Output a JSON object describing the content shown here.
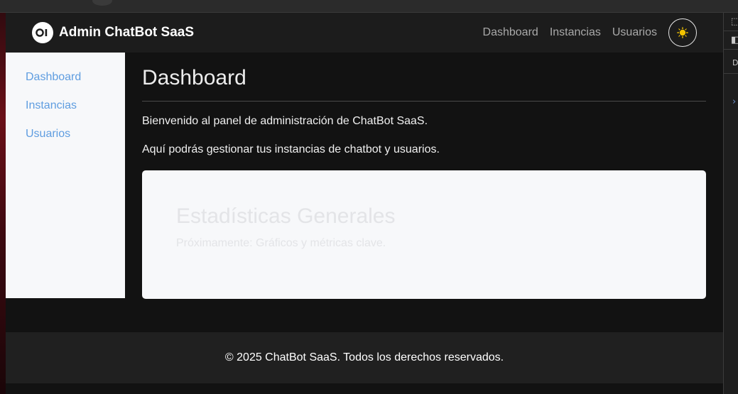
{
  "navbar": {
    "brand_logo": "OI",
    "brand": "Admin ChatBot SaaS",
    "links": [
      "Dashboard",
      "Instancias",
      "Usuarios"
    ],
    "theme_icon": "sun-icon",
    "theme_icon_color": "#f2c200"
  },
  "sidebar": {
    "items": [
      "Dashboard",
      "Instancias",
      "Usuarios"
    ],
    "link_color": "#5f9de0"
  },
  "main": {
    "title": "Dashboard",
    "welcome": "Bienvenido al panel de administración de ChatBot SaaS.",
    "description": "Aquí podrás gestionar tus instancias de chatbot y usuarios.",
    "card": {
      "title": "Estadísticas Generales",
      "subtitle": "Próximamente: Gráficos y métricas clave."
    }
  },
  "footer": {
    "text": "© 2025 ChatBot SaaS. Todos los derechos reservados."
  },
  "devtools": {
    "glyphs": [
      "[",
      "D"
    ]
  },
  "colors": {
    "navbar_bg": "#1c1c1c",
    "page_bg": "#121212",
    "sidebar_bg": "#f7f8fa",
    "card_bg": "#f7f8fa",
    "footer_bg": "#202020"
  }
}
